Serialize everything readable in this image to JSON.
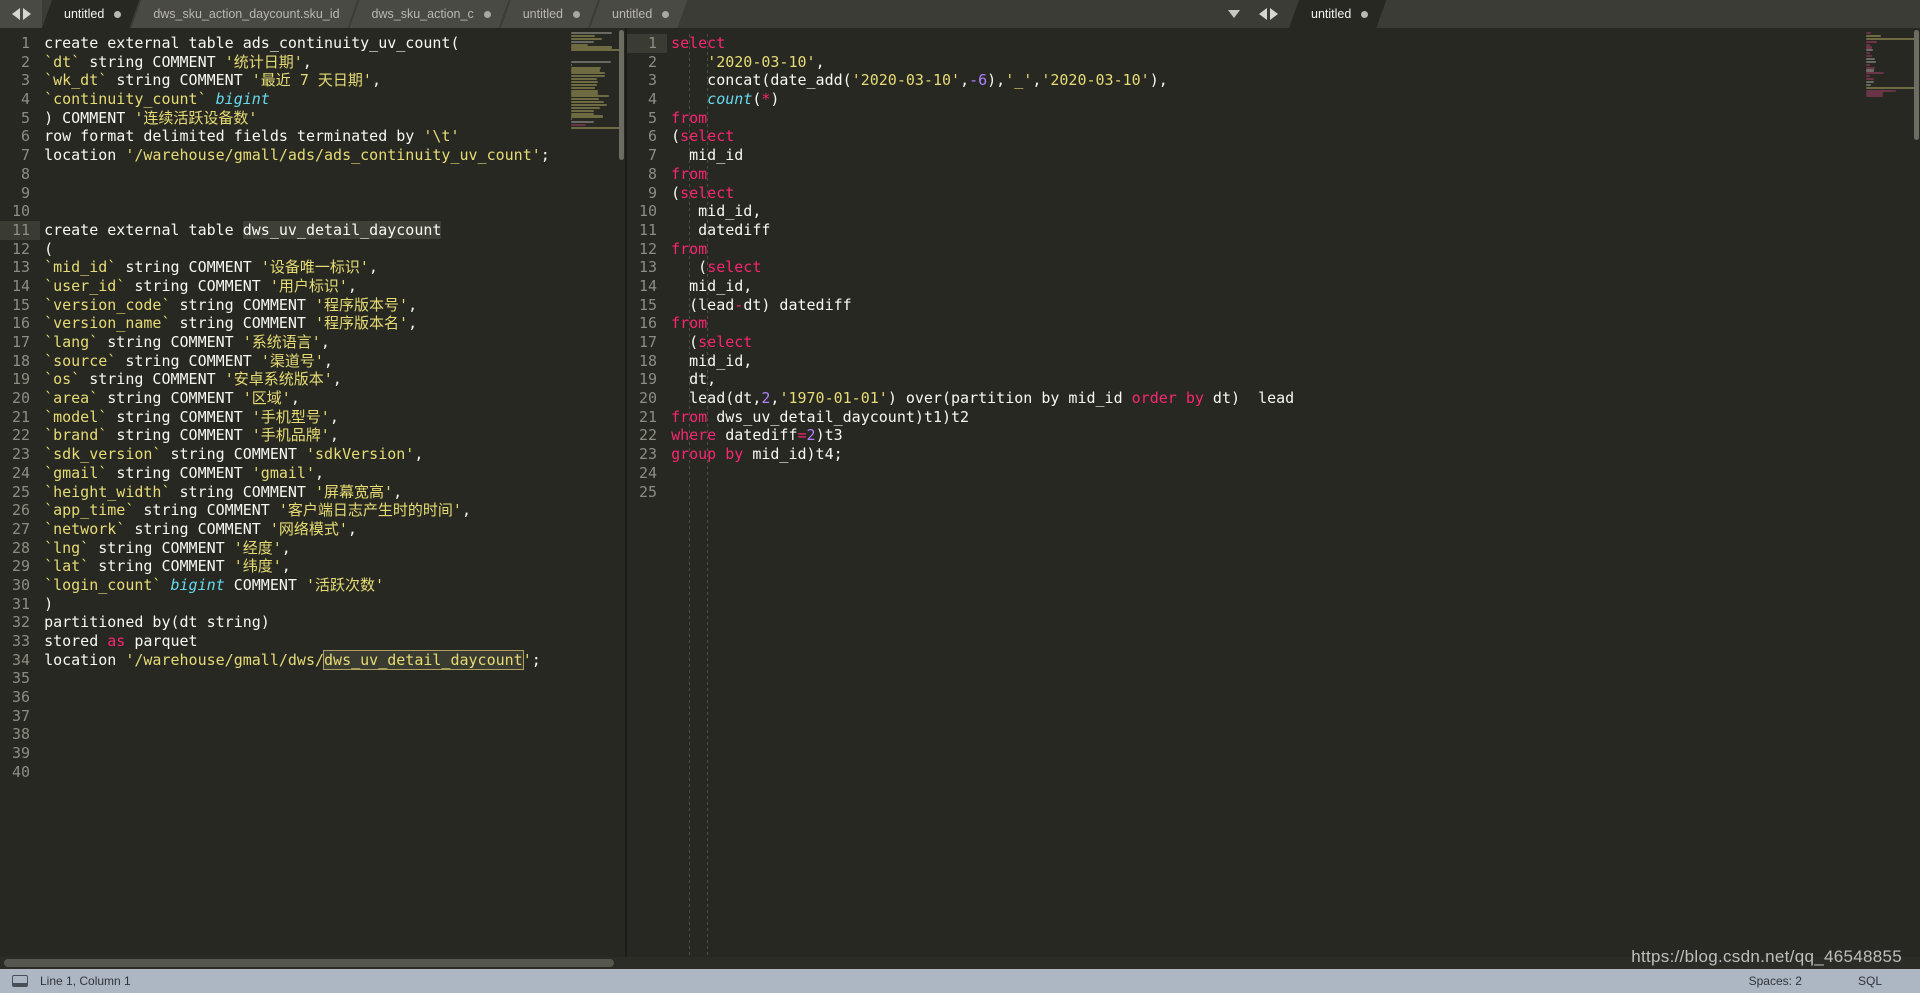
{
  "window": {
    "title": "untitled"
  },
  "tabbar": {
    "nav_prev_icon": "triangle-left-icon",
    "nav_next_icon": "triangle-right-icon",
    "dropdown_icon": "chevron-down-icon",
    "left_group": [
      {
        "label": "untitled",
        "active": true,
        "modified": true
      },
      {
        "label": "dws_sku_action_daycount.sku_id",
        "active": false,
        "modified": false
      },
      {
        "label": "dws_sku_action_c",
        "active": false,
        "modified": true
      },
      {
        "label": "untitled",
        "active": false,
        "modified": true
      },
      {
        "label": "untitled",
        "active": false,
        "modified": true
      }
    ],
    "right_group": [
      {
        "label": "untitled",
        "active": true,
        "modified": true
      }
    ]
  },
  "left_editor": {
    "current_line": 11,
    "first_line": 1,
    "total_lines": 40,
    "lines": [
      {
        "n": 1,
        "tokens": [
          {
            "t": "create external table ads_continuity_uv_count(",
            "c": "pl"
          }
        ]
      },
      {
        "n": 2,
        "tokens": [
          {
            "t": "`dt` ",
            "c": "idq"
          },
          {
            "t": "string COMMENT ",
            "c": "pl"
          },
          {
            "t": "'统计日期'",
            "c": "str"
          },
          {
            "t": ",",
            "c": "pl"
          }
        ]
      },
      {
        "n": 3,
        "tokens": [
          {
            "t": "`wk_dt` ",
            "c": "idq"
          },
          {
            "t": "string COMMENT ",
            "c": "pl"
          },
          {
            "t": "'最近 7 天日期'",
            "c": "str"
          },
          {
            "t": ",",
            "c": "pl"
          }
        ]
      },
      {
        "n": 4,
        "tokens": [
          {
            "t": "`continuity_count` ",
            "c": "idq"
          },
          {
            "t": "bigint",
            "c": "type"
          }
        ]
      },
      {
        "n": 5,
        "tokens": [
          {
            "t": ") COMMENT ",
            "c": "pl"
          },
          {
            "t": "'连续活跃设备数'",
            "c": "str"
          }
        ]
      },
      {
        "n": 6,
        "tokens": [
          {
            "t": "row format delimited fields terminated by ",
            "c": "pl"
          },
          {
            "t": "'\\t'",
            "c": "str"
          }
        ]
      },
      {
        "n": 7,
        "tokens": [
          {
            "t": "location ",
            "c": "pl"
          },
          {
            "t": "'/warehouse/gmall/ads/ads_continuity_uv_count'",
            "c": "str"
          },
          {
            "t": ";",
            "c": "pl"
          }
        ]
      },
      {
        "n": 8,
        "tokens": []
      },
      {
        "n": 9,
        "tokens": []
      },
      {
        "n": 10,
        "tokens": []
      },
      {
        "n": 11,
        "tokens": [
          {
            "t": "create external table ",
            "c": "pl"
          },
          {
            "t": "dws_uv_detail_daycount",
            "c": "pl",
            "hl": "soft"
          }
        ]
      },
      {
        "n": 12,
        "tokens": [
          {
            "t": "(",
            "c": "pl"
          }
        ]
      },
      {
        "n": 13,
        "tokens": [
          {
            "t": "`mid_id` ",
            "c": "idq"
          },
          {
            "t": "string COMMENT ",
            "c": "pl"
          },
          {
            "t": "'设备唯一标识'",
            "c": "str"
          },
          {
            "t": ",",
            "c": "pl"
          }
        ]
      },
      {
        "n": 14,
        "tokens": [
          {
            "t": "`user_id` ",
            "c": "idq"
          },
          {
            "t": "string COMMENT ",
            "c": "pl"
          },
          {
            "t": "'用户标识'",
            "c": "str"
          },
          {
            "t": ",",
            "c": "pl"
          }
        ]
      },
      {
        "n": 15,
        "tokens": [
          {
            "t": "`version_code` ",
            "c": "idq"
          },
          {
            "t": "string COMMENT ",
            "c": "pl"
          },
          {
            "t": "'程序版本号'",
            "c": "str"
          },
          {
            "t": ",",
            "c": "pl"
          }
        ]
      },
      {
        "n": 16,
        "tokens": [
          {
            "t": "`version_name` ",
            "c": "idq"
          },
          {
            "t": "string COMMENT ",
            "c": "pl"
          },
          {
            "t": "'程序版本名'",
            "c": "str"
          },
          {
            "t": ",",
            "c": "pl"
          }
        ]
      },
      {
        "n": 17,
        "tokens": [
          {
            "t": "`lang` ",
            "c": "idq"
          },
          {
            "t": "string COMMENT ",
            "c": "pl"
          },
          {
            "t": "'系统语言'",
            "c": "str"
          },
          {
            "t": ",",
            "c": "pl"
          }
        ]
      },
      {
        "n": 18,
        "tokens": [
          {
            "t": "`source` ",
            "c": "idq"
          },
          {
            "t": "string COMMENT ",
            "c": "pl"
          },
          {
            "t": "'渠道号'",
            "c": "str"
          },
          {
            "t": ",",
            "c": "pl"
          }
        ]
      },
      {
        "n": 19,
        "tokens": [
          {
            "t": "`os` ",
            "c": "idq"
          },
          {
            "t": "string COMMENT ",
            "c": "pl"
          },
          {
            "t": "'安卓系统版本'",
            "c": "str"
          },
          {
            "t": ",",
            "c": "pl"
          }
        ]
      },
      {
        "n": 20,
        "tokens": [
          {
            "t": "`area` ",
            "c": "idq"
          },
          {
            "t": "string COMMENT ",
            "c": "pl"
          },
          {
            "t": "'区域'",
            "c": "str"
          },
          {
            "t": ",",
            "c": "pl"
          }
        ]
      },
      {
        "n": 21,
        "tokens": [
          {
            "t": "`model` ",
            "c": "idq"
          },
          {
            "t": "string COMMENT ",
            "c": "pl"
          },
          {
            "t": "'手机型号'",
            "c": "str"
          },
          {
            "t": ",",
            "c": "pl"
          }
        ]
      },
      {
        "n": 22,
        "tokens": [
          {
            "t": "`brand` ",
            "c": "idq"
          },
          {
            "t": "string COMMENT ",
            "c": "pl"
          },
          {
            "t": "'手机品牌'",
            "c": "str"
          },
          {
            "t": ",",
            "c": "pl"
          }
        ]
      },
      {
        "n": 23,
        "tokens": [
          {
            "t": "`sdk_version` ",
            "c": "idq"
          },
          {
            "t": "string COMMENT ",
            "c": "pl"
          },
          {
            "t": "'sdkVersion'",
            "c": "str"
          },
          {
            "t": ",",
            "c": "pl"
          }
        ]
      },
      {
        "n": 24,
        "tokens": [
          {
            "t": "`gmail` ",
            "c": "idq"
          },
          {
            "t": "string COMMENT ",
            "c": "pl"
          },
          {
            "t": "'gmail'",
            "c": "str"
          },
          {
            "t": ",",
            "c": "pl"
          }
        ]
      },
      {
        "n": 25,
        "tokens": [
          {
            "t": "`height_width` ",
            "c": "idq"
          },
          {
            "t": "string COMMENT ",
            "c": "pl"
          },
          {
            "t": "'屏幕宽高'",
            "c": "str"
          },
          {
            "t": ",",
            "c": "pl"
          }
        ]
      },
      {
        "n": 26,
        "tokens": [
          {
            "t": "`app_time` ",
            "c": "idq"
          },
          {
            "t": "string COMMENT ",
            "c": "pl"
          },
          {
            "t": "'客户端日志产生时的时间'",
            "c": "str"
          },
          {
            "t": ",",
            "c": "pl"
          }
        ]
      },
      {
        "n": 27,
        "tokens": [
          {
            "t": "`network` ",
            "c": "idq"
          },
          {
            "t": "string COMMENT ",
            "c": "pl"
          },
          {
            "t": "'网络模式'",
            "c": "str"
          },
          {
            "t": ",",
            "c": "pl"
          }
        ]
      },
      {
        "n": 28,
        "tokens": [
          {
            "t": "`lng` ",
            "c": "idq"
          },
          {
            "t": "string COMMENT ",
            "c": "pl"
          },
          {
            "t": "'经度'",
            "c": "str"
          },
          {
            "t": ",",
            "c": "pl"
          }
        ]
      },
      {
        "n": 29,
        "tokens": [
          {
            "t": "`lat` ",
            "c": "idq"
          },
          {
            "t": "string COMMENT ",
            "c": "pl"
          },
          {
            "t": "'纬度'",
            "c": "str"
          },
          {
            "t": ",",
            "c": "pl"
          }
        ]
      },
      {
        "n": 30,
        "tokens": [
          {
            "t": "`login_count` ",
            "c": "idq"
          },
          {
            "t": "bigint",
            "c": "type"
          },
          {
            "t": " COMMENT ",
            "c": "pl"
          },
          {
            "t": "'活跃次数'",
            "c": "str"
          }
        ]
      },
      {
        "n": 31,
        "tokens": [
          {
            "t": ")",
            "c": "pl"
          }
        ]
      },
      {
        "n": 32,
        "tokens": [
          {
            "t": "partitioned by(dt string)",
            "c": "pl"
          }
        ]
      },
      {
        "n": 33,
        "tokens": [
          {
            "t": "stored ",
            "c": "pl"
          },
          {
            "t": "as",
            "c": "kw"
          },
          {
            "t": " parquet",
            "c": "pl"
          }
        ]
      },
      {
        "n": 34,
        "tokens": [
          {
            "t": "location ",
            "c": "pl"
          },
          {
            "t": "'/warehouse/gmall/dws/",
            "c": "str"
          },
          {
            "t": "dws_uv_detail_daycount",
            "c": "str",
            "hl": "box"
          },
          {
            "t": "'",
            "c": "str"
          },
          {
            "t": ";",
            "c": "pl"
          }
        ]
      },
      {
        "n": 35,
        "tokens": []
      },
      {
        "n": 36,
        "tokens": []
      },
      {
        "n": 37,
        "tokens": []
      },
      {
        "n": 38,
        "tokens": []
      },
      {
        "n": 39,
        "tokens": []
      },
      {
        "n": 40,
        "tokens": []
      }
    ]
  },
  "right_editor": {
    "current_line": 1,
    "total_lines": 25,
    "lines": [
      {
        "n": 1,
        "tokens": [
          {
            "t": "select",
            "c": "kw"
          }
        ]
      },
      {
        "n": 2,
        "tokens": [
          {
            "t": "    ",
            "c": "pl"
          },
          {
            "t": "'2020-03-10'",
            "c": "str"
          },
          {
            "t": ",",
            "c": "pl"
          }
        ]
      },
      {
        "n": 3,
        "tokens": [
          {
            "t": "    concat(date_add(",
            "c": "pl"
          },
          {
            "t": "'2020-03-10'",
            "c": "str"
          },
          {
            "t": ",",
            "c": "pl"
          },
          {
            "t": "-6",
            "c": "num"
          },
          {
            "t": "),",
            "c": "pl"
          },
          {
            "t": "'_'",
            "c": "str"
          },
          {
            "t": ",",
            "c": "pl"
          },
          {
            "t": "'2020-03-10'",
            "c": "str"
          },
          {
            "t": "),",
            "c": "pl"
          }
        ]
      },
      {
        "n": 4,
        "tokens": [
          {
            "t": "    ",
            "c": "pl"
          },
          {
            "t": "count",
            "c": "type"
          },
          {
            "t": "(",
            "c": "pl"
          },
          {
            "t": "*",
            "c": "kw"
          },
          {
            "t": ")",
            "c": "pl"
          }
        ]
      },
      {
        "n": 5,
        "tokens": [
          {
            "t": "from",
            "c": "kw"
          }
        ]
      },
      {
        "n": 6,
        "tokens": [
          {
            "t": "(",
            "c": "pl"
          },
          {
            "t": "select",
            "c": "kw"
          }
        ]
      },
      {
        "n": 7,
        "tokens": [
          {
            "t": "  mid_id",
            "c": "pl"
          }
        ]
      },
      {
        "n": 8,
        "tokens": [
          {
            "t": "from",
            "c": "kw"
          }
        ]
      },
      {
        "n": 9,
        "tokens": [
          {
            "t": "(",
            "c": "pl"
          },
          {
            "t": "select",
            "c": "kw"
          }
        ]
      },
      {
        "n": 10,
        "tokens": [
          {
            "t": "   mid_id,",
            "c": "pl"
          }
        ]
      },
      {
        "n": 11,
        "tokens": [
          {
            "t": "   datediff",
            "c": "pl"
          }
        ]
      },
      {
        "n": 12,
        "tokens": [
          {
            "t": "from",
            "c": "kw"
          }
        ]
      },
      {
        "n": 13,
        "tokens": [
          {
            "t": "   (",
            "c": "pl"
          },
          {
            "t": "select",
            "c": "kw"
          }
        ]
      },
      {
        "n": 14,
        "tokens": [
          {
            "t": "  mid_id,",
            "c": "pl"
          }
        ]
      },
      {
        "n": 15,
        "tokens": [
          {
            "t": "  (lead",
            "c": "pl"
          },
          {
            "t": "-",
            "c": "kw"
          },
          {
            "t": "dt) datediff",
            "c": "pl"
          }
        ]
      },
      {
        "n": 16,
        "tokens": [
          {
            "t": "from",
            "c": "kw"
          }
        ]
      },
      {
        "n": 17,
        "tokens": [
          {
            "t": "  (",
            "c": "pl"
          },
          {
            "t": "select",
            "c": "kw"
          }
        ]
      },
      {
        "n": 18,
        "tokens": [
          {
            "t": "  mid_id,",
            "c": "pl"
          }
        ]
      },
      {
        "n": 19,
        "tokens": [
          {
            "t": "  dt,",
            "c": "pl"
          }
        ]
      },
      {
        "n": 20,
        "tokens": [
          {
            "t": "  lead(dt,",
            "c": "pl"
          },
          {
            "t": "2",
            "c": "num"
          },
          {
            "t": ",",
            "c": "pl"
          },
          {
            "t": "'1970-01-01'",
            "c": "str"
          },
          {
            "t": ") over(partition by mid_id ",
            "c": "pl"
          },
          {
            "t": "order by",
            "c": "kw"
          },
          {
            "t": " dt)  lead",
            "c": "pl"
          }
        ]
      },
      {
        "n": 21,
        "tokens": [
          {
            "t": "from",
            "c": "kw"
          },
          {
            "t": " dws_uv_detail_daycount)t1)t2",
            "c": "pl"
          }
        ]
      },
      {
        "n": 22,
        "tokens": [
          {
            "t": "where",
            "c": "kw"
          },
          {
            "t": " datediff",
            "c": "pl"
          },
          {
            "t": "=",
            "c": "kw"
          },
          {
            "t": "2",
            "c": "num"
          },
          {
            "t": ")t3",
            "c": "pl"
          }
        ]
      },
      {
        "n": 23,
        "tokens": [
          {
            "t": "group by",
            "c": "kw"
          },
          {
            "t": " mid_id)t4;",
            "c": "pl"
          }
        ]
      },
      {
        "n": 24,
        "tokens": []
      },
      {
        "n": 25,
        "tokens": []
      }
    ]
  },
  "statusbar": {
    "doc_icon": "document-icon",
    "position": "Line 1, Column 1",
    "indent": "Spaces: 2",
    "syntax": "SQL"
  },
  "watermark": {
    "text": "https://blog.csdn.net/qq_46548855"
  },
  "colors": {
    "background": "#272822",
    "keyword": "#f92672",
    "string": "#e6db74",
    "number": "#ae81ff",
    "type": "#66d9ef",
    "plain": "#f8f8f2",
    "gutter": "#8d8d84",
    "tabbar": "#3c3c36",
    "tab_inactive": "#4a4a44",
    "statusbar": "#adb7c4"
  }
}
